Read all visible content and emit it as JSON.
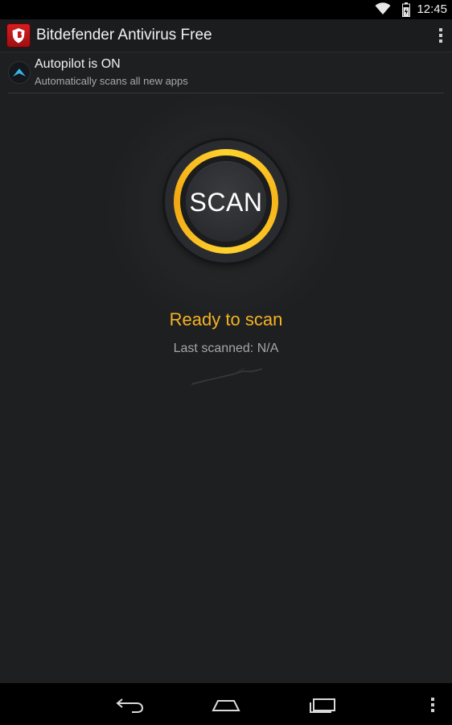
{
  "status_bar": {
    "time": "12:45",
    "icons": [
      "wifi-icon",
      "battery-icon"
    ]
  },
  "action_bar": {
    "title": "Bitdefender Antivirus Free",
    "logo_icon": "bitdefender-shield-icon",
    "menu_icon": "overflow-menu-icon"
  },
  "autopilot": {
    "title": "Autopilot is ON",
    "subtitle": "Automatically scans all new apps",
    "icon": "autopilot-chevron-icon"
  },
  "scan": {
    "button_label": "SCAN",
    "status": "Ready to scan",
    "last_scanned": "Last scanned: N/A"
  },
  "nav_bar": {
    "icons": [
      "back-icon",
      "home-icon",
      "recent-apps-icon",
      "menu-icon"
    ]
  },
  "colors": {
    "accent": "#f6b323",
    "ring": "#ffd22e",
    "background": "#1e1f21",
    "brand_red": "#d81e22",
    "autopilot_blue": "#33b5e5"
  }
}
